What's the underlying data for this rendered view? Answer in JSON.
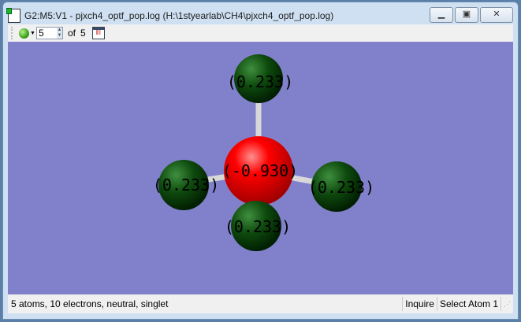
{
  "window": {
    "title": "G2:M5:V1 - pjxch4_optf_pop.log (H:\\1styearlab\\CH4\\pjxch4_optf_pop.log)",
    "minimize": "▁",
    "maximize": "▣",
    "close": "✕"
  },
  "toolbar": {
    "frame_value": "5",
    "of_label": "of",
    "frame_total": "5"
  },
  "molecule": {
    "atoms": [
      {
        "element": "H",
        "charge": "(0.233)",
        "color": "#0e4a0e"
      },
      {
        "element": "C",
        "charge": "(-0.930)",
        "color": "#ff0000"
      },
      {
        "element": "H",
        "charge": "(0.233)",
        "color": "#0e4a0e"
      },
      {
        "element": "H",
        "charge": "(0.233)",
        "color": "#0e4a0e"
      },
      {
        "element": "H",
        "charge": "(0.233)",
        "color": "#0e4a0e"
      }
    ]
  },
  "status": {
    "info": "5 atoms, 10 electrons, neutral, singlet",
    "mode": "Inquire",
    "action": "Select Atom 1"
  }
}
